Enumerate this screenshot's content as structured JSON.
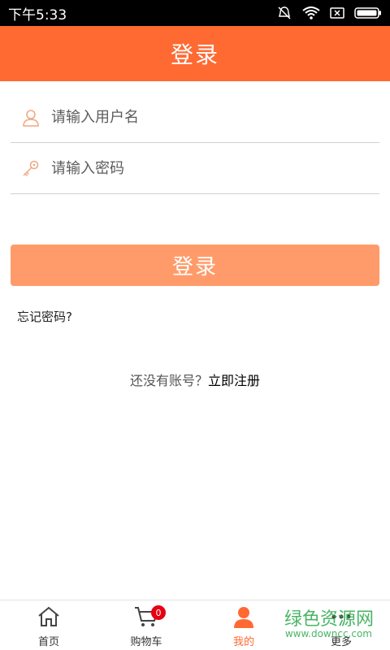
{
  "status_bar": {
    "time": "下午5:33",
    "icons": [
      "mute-bell-icon",
      "wifi-icon",
      "sim-x-icon",
      "battery-icon"
    ]
  },
  "header": {
    "title": "登录"
  },
  "form": {
    "username": {
      "placeholder": "请输入用户名",
      "value": "",
      "icon": "user-icon"
    },
    "password": {
      "placeholder": "请输入密码",
      "value": "",
      "icon": "key-icon"
    },
    "submit_label": "登录",
    "forgot_label": "忘记密码?",
    "register_prompt": "还没有账号？",
    "register_link": "立即注册"
  },
  "bottom_nav": {
    "items": [
      {
        "label": "首页",
        "icon": "home-icon"
      },
      {
        "label": "购物车",
        "icon": "cart-icon",
        "badge": "0"
      },
      {
        "label": "我的",
        "icon": "person-icon",
        "active": true
      },
      {
        "label": "更多",
        "icon": "more-icon"
      }
    ]
  },
  "watermark": {
    "title": "绿色资源网",
    "subtitle": "www.downcc.com"
  },
  "colors": {
    "accent": "#ff6a33",
    "button": "#ff9b6a",
    "badge": "#e60012"
  }
}
